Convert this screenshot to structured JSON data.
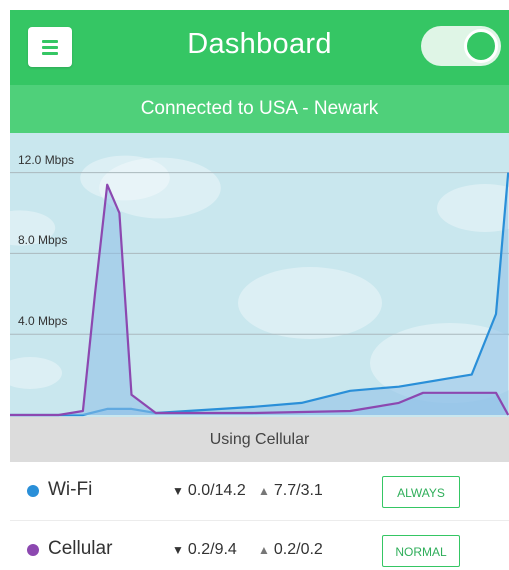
{
  "header": {
    "title": "Dashboard",
    "menu_icon": "hamburger-icon",
    "vpn_toggle": "on"
  },
  "connection": {
    "status": "Connected to USA - Newark"
  },
  "chart_data": {
    "type": "line",
    "ylabel": "",
    "yticks": [
      "4.0 Mbps",
      "8.0 Mbps",
      "12.0 Mbps"
    ],
    "ylim": [
      0,
      14
    ],
    "grid": true,
    "series": [
      {
        "color": "#2a8fd8",
        "points": [
          [
            0,
            0
          ],
          [
            3,
            0
          ],
          [
            4,
            0.3
          ],
          [
            5,
            0.3
          ],
          [
            6,
            0.1
          ],
          [
            10,
            0.4
          ],
          [
            12,
            0.6
          ],
          [
            14,
            1.2
          ],
          [
            15,
            1.3
          ],
          [
            16,
            1.4
          ],
          [
            18,
            1.8
          ],
          [
            19,
            2.0
          ],
          [
            20,
            5.0
          ],
          [
            20.5,
            12.0
          ]
        ]
      },
      {
        "color": "#8c48b0",
        "points": [
          [
            0,
            0
          ],
          [
            2,
            0
          ],
          [
            3,
            0.2
          ],
          [
            3.5,
            6.0
          ],
          [
            4,
            11.4
          ],
          [
            4.5,
            10.0
          ],
          [
            5,
            1.0
          ],
          [
            6,
            0.1
          ],
          [
            10,
            0.1
          ],
          [
            14,
            0.2
          ],
          [
            16,
            0.6
          ],
          [
            17,
            1.1
          ],
          [
            20,
            1.1
          ],
          [
            20.5,
            0
          ]
        ]
      }
    ]
  },
  "status_bar": {
    "text": "Using Cellular"
  },
  "networks": [
    {
      "name": "Wi-Fi",
      "color": "#2a8fd8",
      "down": "0.0/14.2",
      "up": "7.7/3.1",
      "mode": "ALWAYS"
    },
    {
      "name": "Cellular",
      "color": "#8c48b0",
      "down": "0.2/9.4",
      "up": "0.2/0.2",
      "mode": "NORMAL"
    }
  ]
}
